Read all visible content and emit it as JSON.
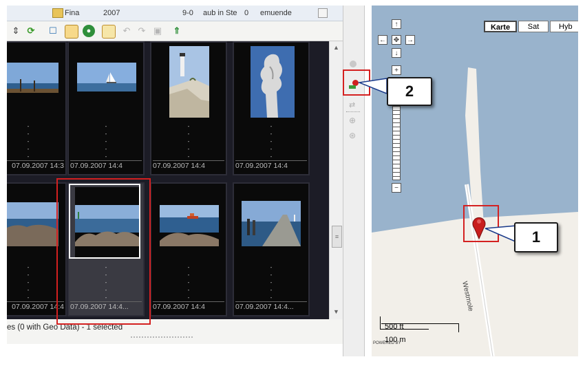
{
  "window": {
    "title_parts": [
      "Fina",
      "2007",
      "9-0",
      "aub in Ste",
      "0",
      "emuende"
    ]
  },
  "toolbar": {
    "icons": [
      "arrows-icon",
      "refresh-icon",
      "comment-icon",
      "edit-icon",
      "globe-icon",
      "notepad-icon",
      "undo-icon",
      "redo-icon",
      "save-icon",
      "tree-icon"
    ]
  },
  "thumbnails": {
    "dash": "-",
    "rows": [
      [
        {
          "date": "07.09.2007 14:3",
          "scene": "pier"
        },
        {
          "date": "07.09.2007 14:4",
          "scene": "sailboat"
        },
        {
          "date": "07.09.2007 14:4",
          "scene": "lighthouse"
        },
        {
          "date": "07.09.2007 14:4",
          "scene": "statue"
        }
      ],
      [
        {
          "date": "07.09.2007 14:4",
          "scene": "rocks-beach"
        },
        {
          "date": "07.09.2007 14:4...",
          "scene": "rocks-sea",
          "selected": true
        },
        {
          "date": "07.09.2007 14:4",
          "scene": "ship"
        },
        {
          "date": "07.09.2007 14:4...",
          "scene": "jetty"
        }
      ]
    ]
  },
  "status": {
    "text": "es (0 with Geo Data) - 1 selected"
  },
  "map": {
    "type_buttons": [
      "Karte",
      "Sat",
      "Hyb"
    ],
    "active_type": "Karte",
    "pan_arrows": [
      "↑",
      "←",
      "✥",
      "→",
      "↓"
    ],
    "zoom_in": "+",
    "zoom_out": "−",
    "road_label": "Westmole",
    "scale": {
      "top": "500 ft",
      "bottom": "100 m"
    },
    "powered_by": "POWERED BY"
  },
  "callouts": {
    "marker": "1",
    "tool": "2"
  },
  "colors": {
    "water": "#99b3cc",
    "land": "#f2efe9",
    "highlight": "#d42020",
    "grid_bg": "#1c1c26"
  }
}
